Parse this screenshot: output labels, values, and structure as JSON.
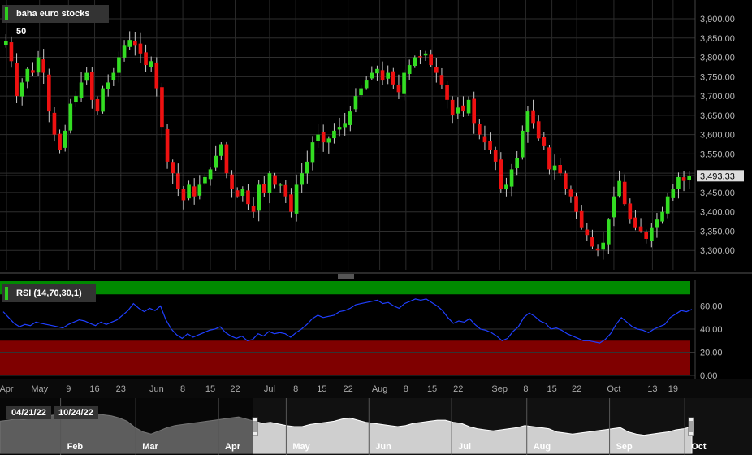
{
  "chart_data": [
    {
      "type": "candlestick",
      "title": "baha euro stocks 50",
      "y_ticks": [
        "3,300.00",
        "3,350.00",
        "3,400.00",
        "3,450.00",
        "3,500.00",
        "3,550.00",
        "3,600.00",
        "3,650.00",
        "3,700.00",
        "3,750.00",
        "3,800.00",
        "3,850.00",
        "3,900.00"
      ],
      "ylim": [
        3250,
        3940
      ],
      "current_value": 3493.33,
      "current_value_label": "3,493.33",
      "x_ticks": [
        "Apr",
        "May",
        "9",
        "16",
        "23",
        "Jun",
        "8",
        "15",
        "22",
        "Jul",
        "8",
        "15",
        "22",
        "Aug",
        "8",
        "15",
        "22",
        "Sep",
        "8",
        "15",
        "22",
        "Oct",
        "13",
        "19"
      ],
      "closes": [
        3842,
        3790,
        3700,
        3735,
        3770,
        3760,
        3800,
        3760,
        3660,
        3600,
        3560,
        3610,
        3680,
        3700,
        3735,
        3760,
        3690,
        3660,
        3720,
        3735,
        3760,
        3800,
        3830,
        3845,
        3830,
        3810,
        3780,
        3790,
        3720,
        3620,
        3530,
        3500,
        3460,
        3430,
        3470,
        3440,
        3470,
        3490,
        3510,
        3545,
        3575,
        3500,
        3460,
        3440,
        3460,
        3420,
        3400,
        3470,
        3450,
        3500,
        3470,
        3470,
        3440,
        3400,
        3470,
        3500,
        3530,
        3580,
        3600,
        3580,
        3590,
        3610,
        3620,
        3630,
        3660,
        3700,
        3720,
        3740,
        3760,
        3770,
        3740,
        3760,
        3730,
        3710,
        3760,
        3780,
        3800,
        3800,
        3810,
        3780,
        3760,
        3730,
        3690,
        3650,
        3670,
        3660,
        3690,
        3630,
        3600,
        3580,
        3560,
        3530,
        3460,
        3470,
        3510,
        3540,
        3610,
        3660,
        3630,
        3590,
        3570,
        3510,
        3520,
        3500,
        3460,
        3440,
        3400,
        3360,
        3340,
        3310,
        3300,
        3320,
        3380,
        3440,
        3480,
        3420,
        3380,
        3360,
        3350,
        3330,
        3360,
        3380,
        3400,
        3440,
        3460,
        3490,
        3480,
        3493.33
      ],
      "rsi": {
        "title": "RSI (14,70,30,1)",
        "y_ticks": [
          "0.00",
          "20.00",
          "40.00",
          "60.00"
        ],
        "ylim": [
          0,
          80
        ],
        "overbought": 70,
        "oversold": 30,
        "values": [
          55,
          50,
          45,
          42,
          44,
          43,
          46,
          45,
          44,
          43,
          42,
          41,
          44,
          46,
          48,
          47,
          45,
          43,
          46,
          44,
          46,
          48,
          52,
          56,
          62,
          58,
          55,
          58,
          56,
          60,
          48,
          40,
          35,
          32,
          36,
          33,
          35,
          37,
          39,
          40,
          42,
          37,
          34,
          32,
          34,
          30,
          31,
          36,
          34,
          38,
          36,
          37,
          36,
          33,
          37,
          40,
          44,
          49,
          52,
          50,
          51,
          52,
          55,
          56,
          58,
          61,
          62,
          63,
          64,
          65,
          62,
          63,
          60,
          58,
          62,
          64,
          66,
          65,
          66,
          63,
          60,
          56,
          50,
          45,
          47,
          46,
          49,
          44,
          40,
          39,
          37,
          34,
          30,
          32,
          38,
          42,
          50,
          54,
          51,
          47,
          45,
          40,
          41,
          39,
          36,
          34,
          32,
          30,
          30,
          29,
          28,
          31,
          36,
          44,
          50,
          46,
          42,
          40,
          39,
          37,
          40,
          42,
          44,
          50,
          53,
          56,
          55,
          57
        ]
      }
    },
    {
      "type": "area",
      "title": "navigator",
      "x_ticks": [
        "Feb",
        "Mar",
        "Apr",
        "May",
        "Jun",
        "Jul",
        "Aug",
        "Sep",
        "Oct"
      ],
      "range_from": "04/21/22",
      "range_to": "10/24/22",
      "values": [
        60,
        62,
        64,
        63,
        66,
        68,
        70,
        72,
        74,
        73,
        75,
        76,
        74,
        72,
        70,
        66,
        60,
        48,
        40,
        36,
        42,
        48,
        52,
        54,
        56,
        58,
        60,
        62,
        64,
        66,
        68,
        64,
        60,
        56,
        58,
        55,
        52,
        50,
        50,
        54,
        56,
        58,
        60,
        64,
        66,
        62,
        58,
        56,
        54,
        52,
        50,
        52,
        56,
        58,
        60,
        62,
        62,
        58,
        56,
        50,
        46,
        44,
        42,
        44,
        46,
        48,
        52,
        50,
        48,
        46,
        40,
        38,
        36,
        38,
        40,
        42,
        44,
        46,
        48,
        40,
        36,
        34,
        36,
        38,
        40,
        44,
        46,
        50
      ]
    }
  ]
}
